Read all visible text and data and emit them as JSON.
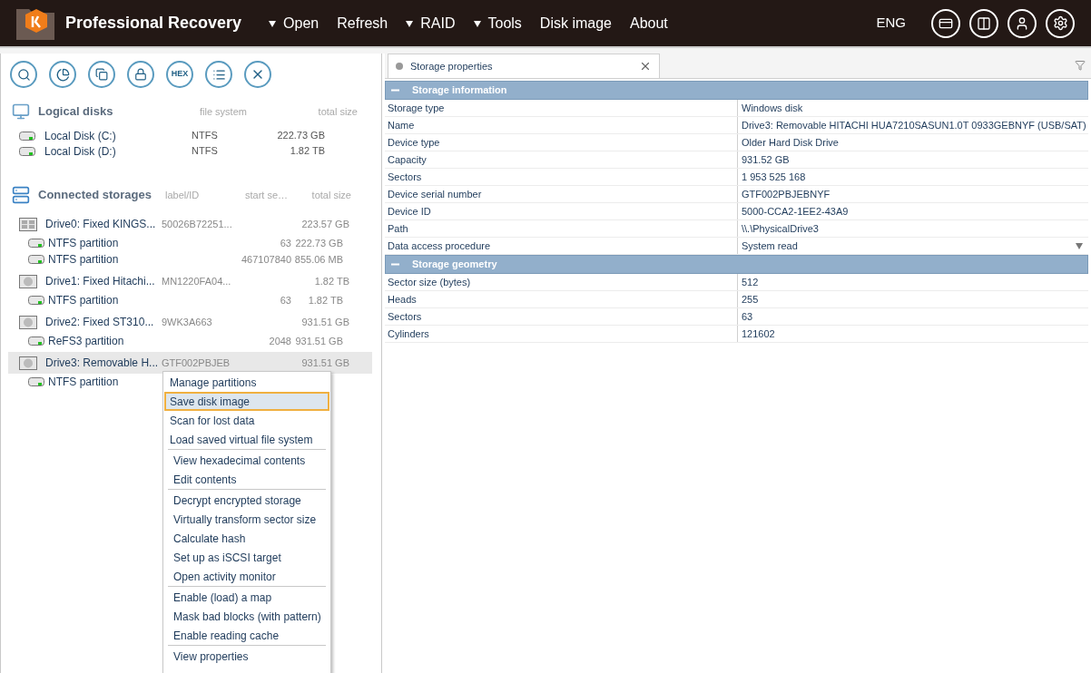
{
  "header": {
    "app_title": "Professional Recovery",
    "menu": [
      {
        "label": "Open",
        "dropdown": true
      },
      {
        "label": "Refresh",
        "dropdown": false
      },
      {
        "label": "RAID",
        "dropdown": true
      },
      {
        "label": "Tools",
        "dropdown": true
      },
      {
        "label": "Disk image",
        "dropdown": false
      },
      {
        "label": "About",
        "dropdown": false
      }
    ],
    "language": "ENG"
  },
  "toolbar": {
    "hex_label": "HEX"
  },
  "logical_disks": {
    "title": "Logical disks",
    "columns": [
      "file system",
      "total size"
    ],
    "rows": [
      {
        "name": "Local Disk (C:)",
        "file_system": "NTFS",
        "total_size": "222.73 GB"
      },
      {
        "name": "Local Disk (D:)",
        "file_system": "NTFS",
        "total_size": "1.82 TB"
      }
    ]
  },
  "connected_storages": {
    "title": "Connected storages",
    "columns": [
      "label/ID",
      "start se…",
      "total size"
    ],
    "items": [
      {
        "name": "Drive0: Fixed KINGS...",
        "label_id": "50026B72251...",
        "total_size": "223.57 GB",
        "kind": "ssd",
        "selected": false,
        "children": [
          {
            "name": "NTFS partition",
            "start_sector": "63",
            "total_size": "222.73 GB"
          },
          {
            "name": "NTFS partition",
            "start_sector": "467107840",
            "total_size": "855.06 MB"
          }
        ]
      },
      {
        "name": "Drive1: Fixed Hitachi...",
        "label_id": "MN1220FA04...",
        "total_size": "1.82 TB",
        "kind": "hdd",
        "selected": false,
        "children": [
          {
            "name": "NTFS partition",
            "start_sector": "63",
            "total_size": "1.82 TB"
          }
        ]
      },
      {
        "name": "Drive2: Fixed ST310...",
        "label_id": "9WK3A663",
        "total_size": "931.51 GB",
        "kind": "hdd",
        "selected": false,
        "children": [
          {
            "name": "ReFS3 partition",
            "start_sector": "2048",
            "total_size": "931.51 GB"
          }
        ]
      },
      {
        "name": "Drive3: Removable H...",
        "label_id": "GTF002PBJEB",
        "total_size": "931.51 GB",
        "kind": "hdd",
        "selected": true,
        "children": [
          {
            "name": "NTFS partition"
          }
        ]
      }
    ]
  },
  "context_menu": {
    "groups": [
      [
        {
          "label": "Manage partitions",
          "selected": false
        },
        {
          "label": "Save disk image",
          "selected": true
        },
        {
          "label": "Scan for lost data",
          "selected": false
        },
        {
          "label": "Load saved virtual file system",
          "selected": false
        }
      ],
      [
        {
          "label": "View hexadecimal contents",
          "selected": false
        },
        {
          "label": "Edit contents",
          "selected": false
        }
      ],
      [
        {
          "label": "Decrypt encrypted storage",
          "selected": false
        },
        {
          "label": "Virtually transform sector size",
          "selected": false
        },
        {
          "label": "Calculate hash",
          "selected": false
        },
        {
          "label": "Set up as iSCSI target",
          "selected": false
        },
        {
          "label": "Open activity monitor",
          "selected": false
        }
      ],
      [
        {
          "label": "Enable (load) a map",
          "selected": false
        },
        {
          "label": "Mask bad blocks (with pattern)",
          "selected": false
        },
        {
          "label": "Enable reading cache",
          "selected": false
        }
      ],
      [
        {
          "label": "View properties",
          "selected": false
        }
      ]
    ]
  },
  "tab": {
    "label": "Storage properties",
    "selected": true
  },
  "properties": {
    "sections": [
      {
        "title": "Storage information",
        "expanded": true,
        "rows": [
          {
            "name": "Storage type",
            "value": "Windows disk",
            "kind": "text"
          },
          {
            "name": "Name",
            "value": "Drive3: Removable HITACHI HUA7210SASUN1.0T 0933GEBNYF (USB/SAT)",
            "kind": "text"
          },
          {
            "name": "Device type",
            "value": "Older Hard Disk Drive",
            "kind": "text"
          },
          {
            "name": "Capacity",
            "value": "931.52 GB",
            "kind": "text"
          },
          {
            "name": "Sectors",
            "value": "1 953 525 168",
            "kind": "text"
          },
          {
            "name": "Device serial number",
            "value": "GTF002PBJEBNYF",
            "kind": "text"
          },
          {
            "name": "Device ID",
            "value": "5000-CCA2-1EE2-43A9",
            "kind": "text"
          },
          {
            "name": "Path",
            "value": "\\\\.\\PhysicalDrive3",
            "kind": "text"
          },
          {
            "name": "Data access procedure",
            "value": "System read",
            "kind": "dropdown"
          }
        ]
      },
      {
        "title": "Storage geometry",
        "expanded": true,
        "rows": [
          {
            "name": "Sector size (bytes)",
            "value": "512",
            "kind": "text"
          },
          {
            "name": "Heads",
            "value": "255",
            "kind": "text"
          },
          {
            "name": "Sectors",
            "value": "63",
            "kind": "text"
          },
          {
            "name": "Cylinders",
            "value": "121602",
            "kind": "text"
          }
        ]
      }
    ]
  }
}
